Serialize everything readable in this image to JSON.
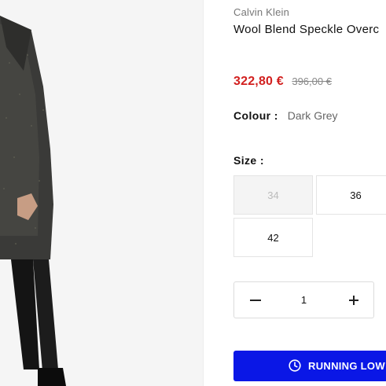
{
  "product": {
    "brand": "Calvin Klein",
    "title": "Wool Blend Speckle Overc",
    "price": {
      "sale": "322,80 €",
      "original": "396,00 €",
      "sale_color": "#d2201f"
    },
    "colour": {
      "label": "Colour :",
      "value": "Dark Grey"
    },
    "size": {
      "label": "Size :",
      "options": [
        {
          "label": "34",
          "available": false
        },
        {
          "label": "36",
          "available": true
        },
        {
          "label": "42",
          "available": true
        }
      ]
    },
    "quantity": {
      "value": "1"
    },
    "cta": {
      "label": "RUNNING LOW",
      "icon": "clock-icon",
      "color": "#0a17e6"
    }
  }
}
